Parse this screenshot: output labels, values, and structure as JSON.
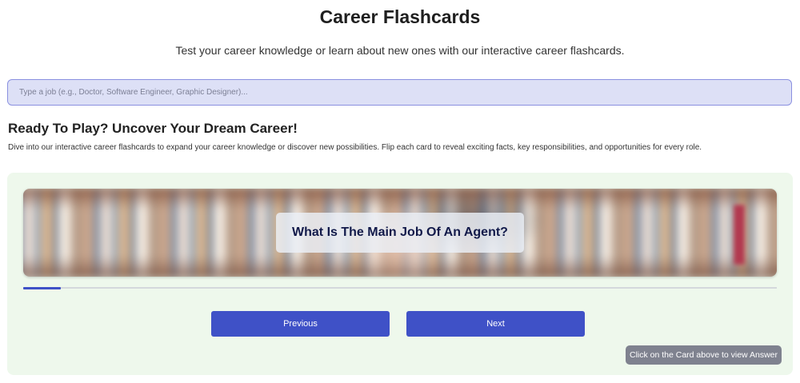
{
  "header": {
    "title": "Career Flashcards",
    "subtitle": "Test your career knowledge or learn about new ones with our interactive career flashcards."
  },
  "search": {
    "placeholder": "Type a job (e.g., Doctor, Software Engineer, Graphic Designer)...",
    "value": ""
  },
  "intro": {
    "heading": "Ready To Play? Uncover Your Dream Career!",
    "description": "Dive into our interactive career flashcards to expand your career knowledge or discover new possibilities. Flip each card to reveal exciting facts, key responsibilities, and opportunities for every role."
  },
  "flashcard": {
    "question": "What Is The Main Job Of An Agent?",
    "progress_fraction": 0.05
  },
  "controls": {
    "previous_label": "Previous",
    "next_label": "Next",
    "hint": "Click on the Card above to view Answer"
  },
  "colors": {
    "accent": "#3f51c7",
    "panel_bg": "#eef8ec",
    "search_bg": "#dde0f6",
    "question_text": "#121a4a",
    "hint_bg": "#7f828f"
  }
}
